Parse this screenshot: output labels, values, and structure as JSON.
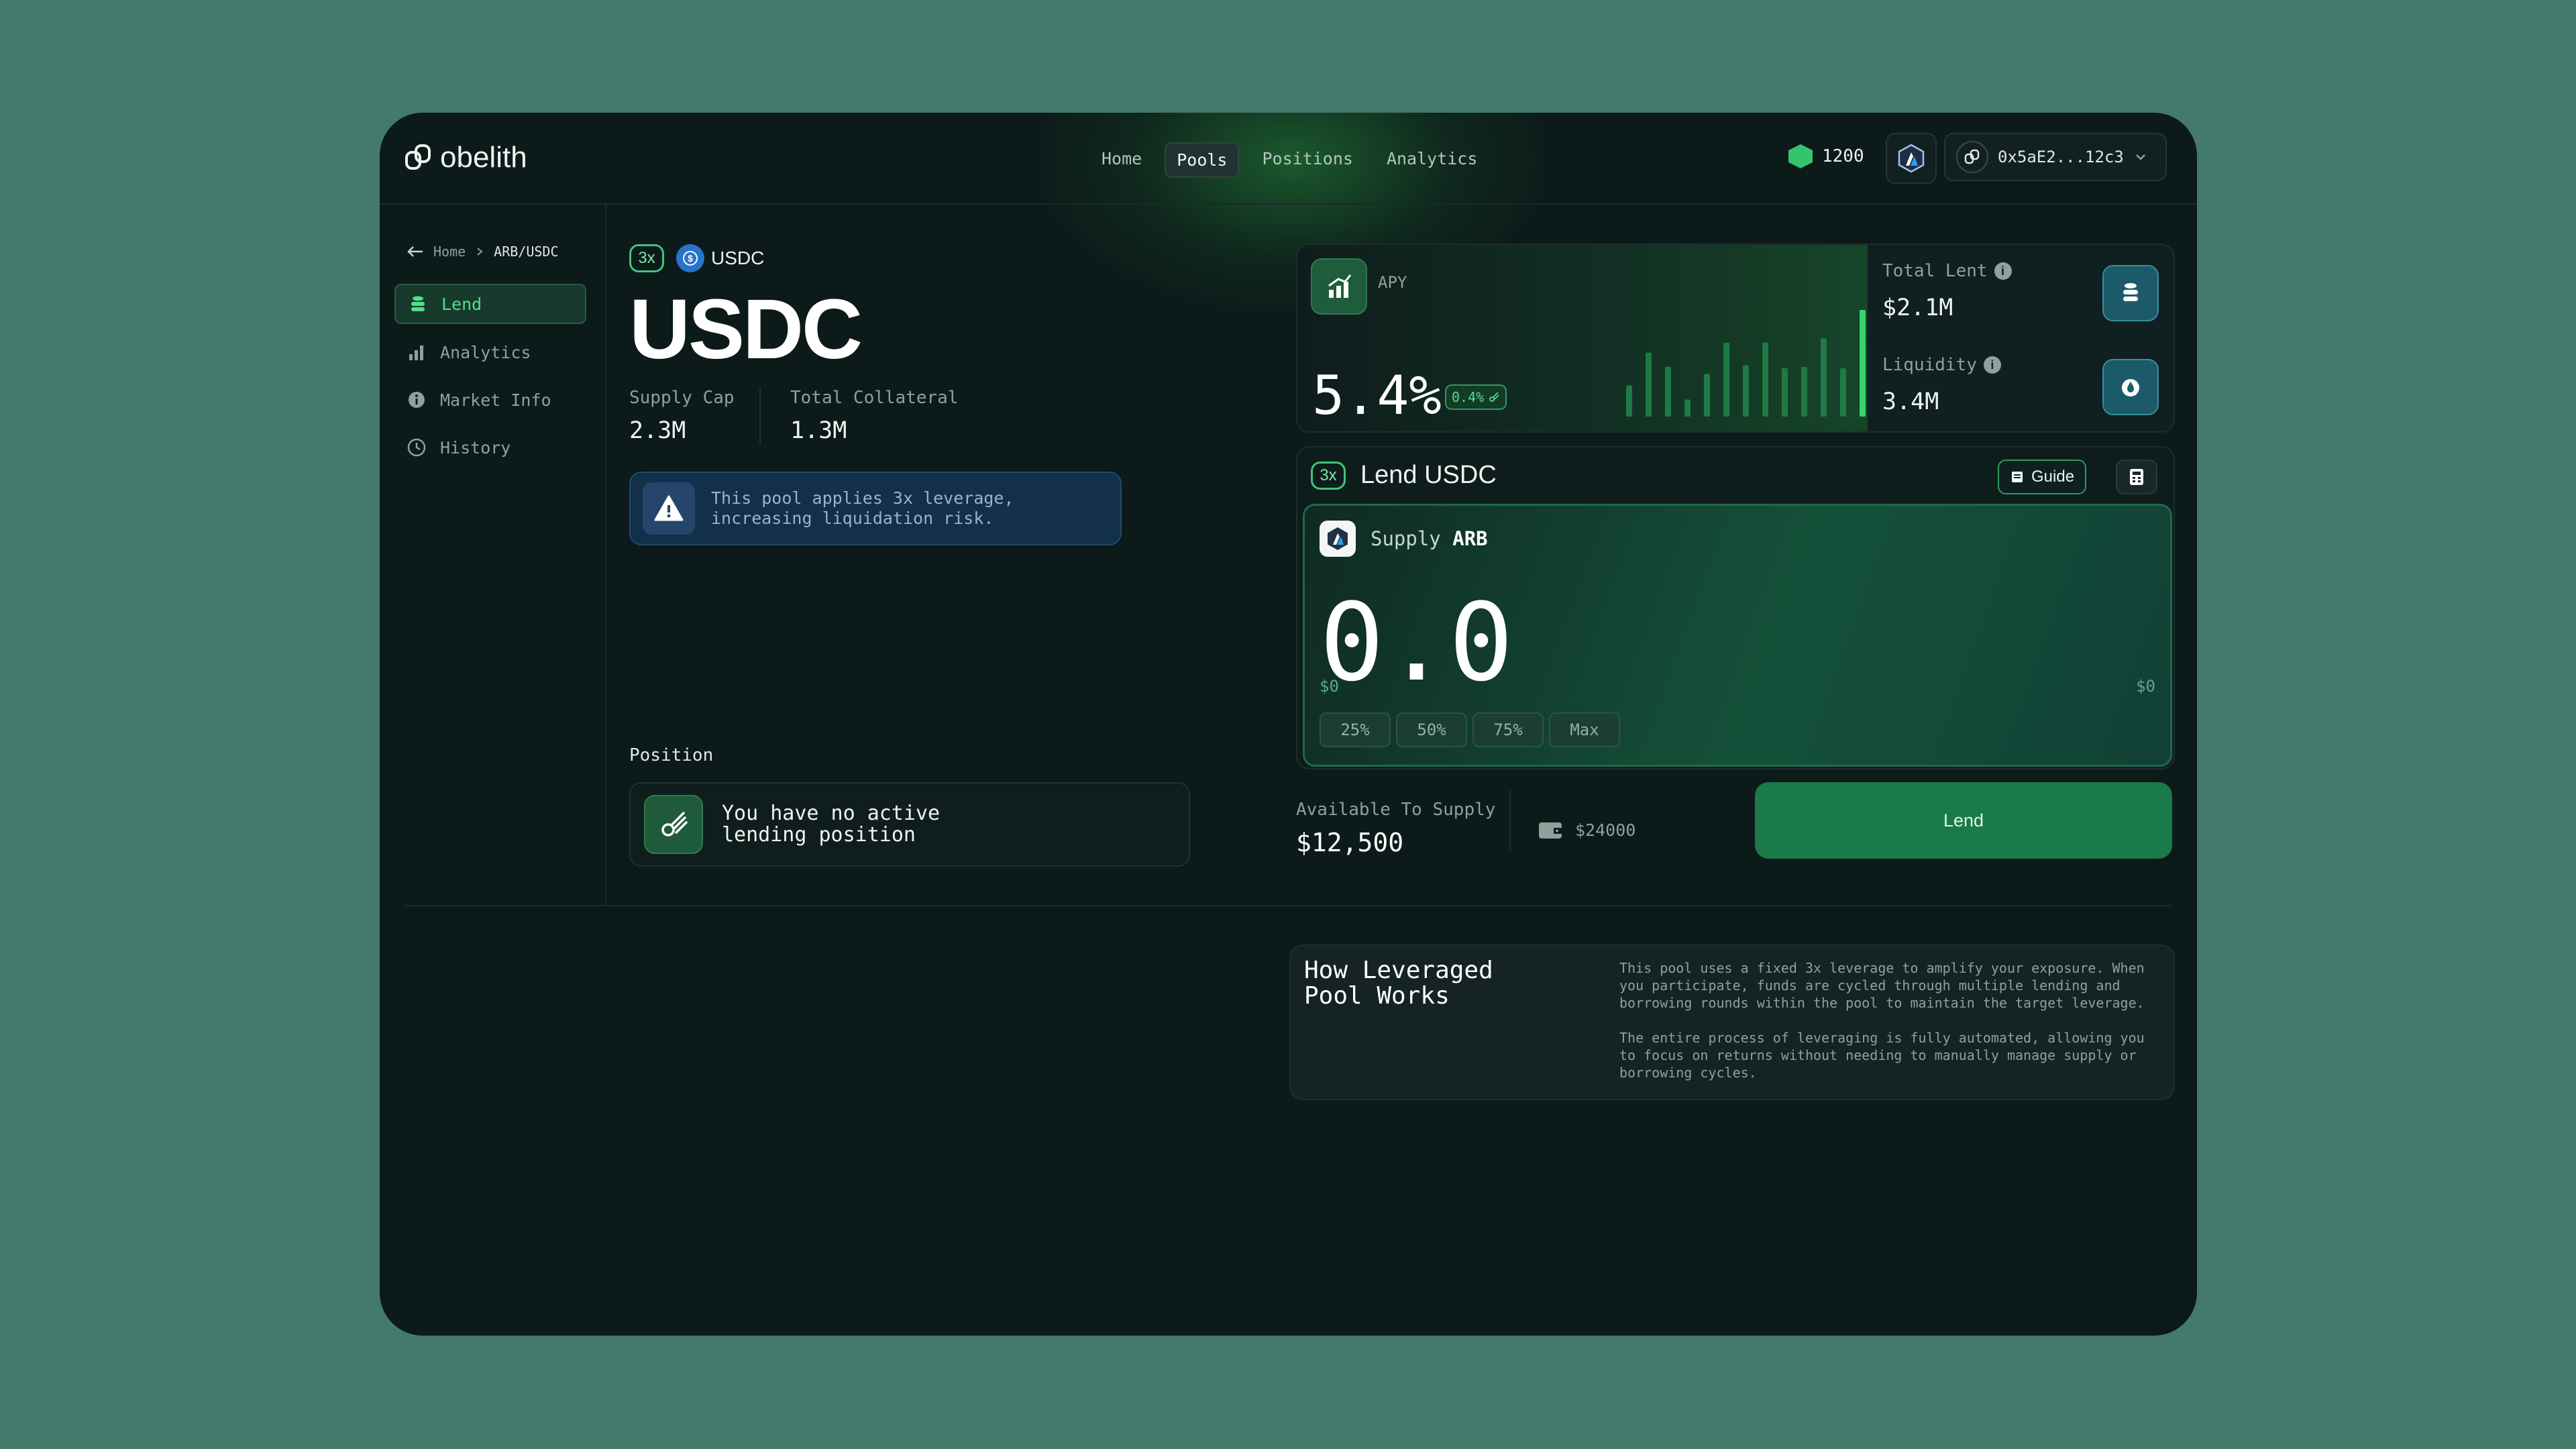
{
  "header": {
    "logo_text": "obelith",
    "nav": [
      {
        "label": "Home",
        "active": false
      },
      {
        "label": "Pools",
        "active": true
      },
      {
        "label": "Positions",
        "active": false
      },
      {
        "label": "Analytics",
        "active": false
      }
    ],
    "points_balance": "1200",
    "network_icon": "arbitrum-icon",
    "wallet_address": "0x5aE2...12c3"
  },
  "breadcrumb": {
    "home": "Home",
    "current": "ARB/USDC"
  },
  "sidebar": {
    "items": [
      {
        "label": "Lend",
        "icon": "coin-stack-icon",
        "active": true
      },
      {
        "label": "Analytics",
        "icon": "bar-chart-icon",
        "active": false
      },
      {
        "label": "Market Info",
        "icon": "info-icon",
        "active": false
      },
      {
        "label": "History",
        "icon": "clock-icon",
        "active": false
      }
    ]
  },
  "asset": {
    "leverage_badge": "3x",
    "symbol": "USDC",
    "title": "USDC",
    "supply_cap_label": "Supply Cap",
    "supply_cap_value": "2.3M",
    "total_collateral_label": "Total Collateral",
    "total_collateral_value": "1.3M",
    "warning_text": "This pool applies 3x leverage, increasing liquidation risk."
  },
  "position": {
    "label": "Position",
    "empty_text": "You have no active lending position"
  },
  "apy": {
    "label": "APY",
    "value": "5.4%",
    "chip": "0.4%",
    "bar_levels": [
      0.22,
      0.45,
      0.35,
      0.12,
      0.3,
      0.52,
      0.36,
      0.52,
      0.34,
      0.35,
      0.55,
      0.34,
      0.75
    ]
  },
  "stats": {
    "total_lent_label": "Total Lent",
    "total_lent_value": "$2.1M",
    "liquidity_label": "Liquidity",
    "liquidity_value": "3.4M"
  },
  "lend": {
    "badge": "3x",
    "title": "Lend USDC",
    "guide_label": "Guide",
    "supply_label": "Supply",
    "supply_token": "ARB",
    "amount": "0.0",
    "usd_left": "$0",
    "usd_right": "$0",
    "percent_buttons": [
      "25%",
      "50%",
      "75%",
      "Max"
    ],
    "available_label": "Available To Supply",
    "available_value": "$12,500",
    "wallet_balance": "$24000",
    "button_label": "Lend"
  },
  "info": {
    "title": "How Leveraged Pool Works",
    "paragraph1": "This pool uses a fixed 3x leverage to amplify your exposure. When you participate, funds are cycled through multiple lending and borrowing rounds within the pool to maintain the target leverage.",
    "paragraph2": "The entire process of leveraging is fully automated, allowing you to focus on returns without needing to manually manage supply or borrowing cycles."
  },
  "colors": {
    "page_bg": "#437a6b",
    "panel_bg": "#0d1a1a",
    "accent_green": "#1a7a48",
    "bright_green": "#4fe08a",
    "warning_blue": "#12304a"
  }
}
